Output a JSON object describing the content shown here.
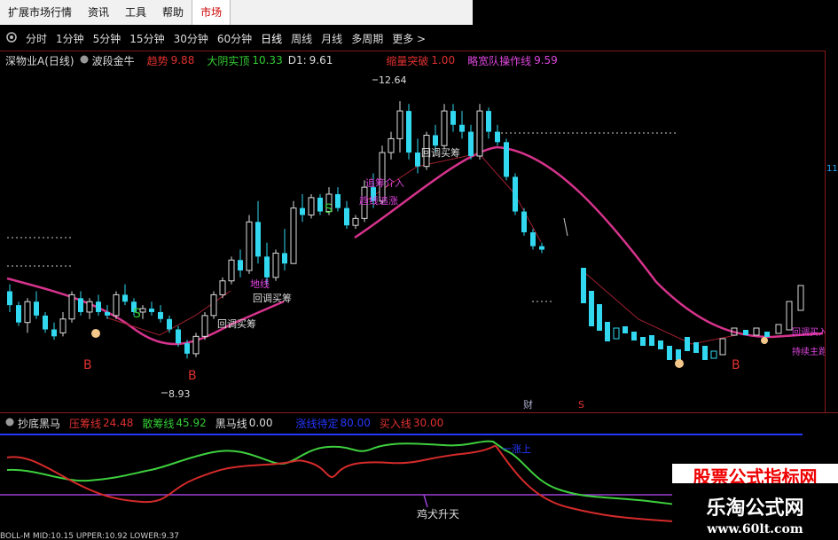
{
  "menu": {
    "items": [
      "扩展市场行情",
      "资讯",
      "工具",
      "帮助"
    ],
    "active": "市场"
  },
  "periods": {
    "items": [
      "分时",
      "1分钟",
      "5分钟",
      "15分钟",
      "30分钟",
      "60分钟",
      "日线",
      "周线",
      "月线",
      "多周期",
      "更多 >"
    ]
  },
  "main_indicators": {
    "stock": "深物业A(日线)",
    "formula": "波段金牛",
    "trend_label": "趋势",
    "trend_value": "9.88",
    "yang_label": "大阴实顶",
    "yang_value": "10.33",
    "d1_label": "D1:",
    "d1_value": "9.61",
    "shrink_label": "缩量突破",
    "shrink_value": "1.00",
    "operate_label": "略宽队操作线",
    "operate_value": "9.59"
  },
  "annotations": {
    "high": "12.64",
    "low": "8.93",
    "callback": "回调买筹",
    "callback2": "回调买筹",
    "callback3": "回调买筹",
    "buy_big": "地线",
    "trend_buy": "趋线追涨",
    "buy_left": "追筹介入",
    "buy_right": "回调买入",
    "right_label": "持续主跑",
    "b": "B",
    "s": "S",
    "cai": "财",
    "s2": "S",
    "axis_marker": "11"
  },
  "sub_indicators": {
    "name": "抄底黑马",
    "pressure_label": "压筹线",
    "pressure_value": "24.48",
    "retail_label": "散筹线",
    "retail_value": "45.92",
    "horse_label": "黑马线",
    "horse_value": "0.00",
    "neutral_label": "涨线待定",
    "neutral_value": "80.00",
    "buy_label": "买入线",
    "buy_value": "30.00",
    "signal": "鸡犬升天",
    "signal2": "一涨上"
  },
  "watermark": {
    "top": "股票公式指标网",
    "title": "乐淘公式网",
    "url": "www.60lt.com"
  },
  "bottom": {
    "text": "BOLL-M  MID:10.15  UPPER:10.92  LOWER:9.37"
  },
  "chart_data": {
    "type": "candlestick",
    "price_range": [
      8.5,
      13.0
    ],
    "sub_range": [
      0,
      100
    ],
    "candles": [
      [
        9.9,
        10.0,
        9.6,
        9.7
      ],
      [
        9.7,
        9.75,
        9.4,
        9.45
      ],
      [
        9.45,
        9.8,
        9.3,
        9.75
      ],
      [
        9.75,
        9.9,
        9.5,
        9.55
      ],
      [
        9.55,
        9.6,
        9.3,
        9.35
      ],
      [
        9.35,
        9.45,
        9.2,
        9.25
      ],
      [
        9.3,
        9.6,
        9.25,
        9.5
      ],
      [
        9.5,
        9.9,
        9.45,
        9.85
      ],
      [
        9.8,
        9.9,
        9.55,
        9.6
      ],
      [
        9.6,
        9.8,
        9.5,
        9.75
      ],
      [
        9.75,
        9.85,
        9.55,
        9.6
      ],
      [
        9.6,
        9.7,
        9.5,
        9.55
      ],
      [
        9.55,
        9.9,
        9.5,
        9.85
      ],
      [
        9.85,
        10.0,
        9.7,
        9.75
      ],
      [
        9.75,
        9.8,
        9.55,
        9.6
      ],
      [
        9.6,
        9.7,
        9.5,
        9.65
      ],
      [
        9.65,
        9.75,
        9.55,
        9.6
      ],
      [
        9.6,
        9.7,
        9.45,
        9.5
      ],
      [
        9.5,
        9.55,
        9.3,
        9.35
      ],
      [
        9.35,
        9.4,
        9.1,
        9.15
      ],
      [
        9.15,
        9.2,
        8.93,
        9.0
      ],
      [
        9.0,
        9.3,
        8.95,
        9.25
      ],
      [
        9.25,
        9.6,
        9.2,
        9.55
      ],
      [
        9.55,
        9.9,
        9.5,
        9.85
      ],
      [
        9.85,
        10.1,
        9.8,
        10.05
      ],
      [
        10.05,
        10.4,
        10.0,
        10.35
      ],
      [
        10.35,
        10.5,
        10.1,
        10.2
      ],
      [
        10.2,
        11.0,
        10.15,
        10.9
      ],
      [
        10.9,
        11.2,
        10.3,
        10.4
      ],
      [
        10.4,
        10.6,
        10.0,
        10.1
      ],
      [
        10.1,
        10.5,
        10.05,
        10.45
      ],
      [
        10.45,
        10.8,
        10.2,
        10.3
      ],
      [
        10.3,
        11.2,
        10.3,
        11.1
      ],
      [
        11.1,
        11.3,
        10.9,
        11.0
      ],
      [
        11.0,
        11.3,
        10.95,
        11.25
      ],
      [
        11.25,
        11.3,
        11.0,
        11.05
      ],
      [
        11.05,
        11.4,
        11.0,
        11.3
      ],
      [
        11.3,
        11.4,
        11.05,
        11.1
      ],
      [
        11.1,
        11.2,
        10.8,
        10.85
      ],
      [
        10.85,
        11.0,
        10.8,
        10.95
      ],
      [
        10.95,
        11.5,
        10.9,
        11.4
      ],
      [
        11.4,
        11.6,
        11.1,
        11.2
      ],
      [
        11.2,
        12.0,
        11.15,
        11.9
      ],
      [
        11.9,
        12.2,
        11.8,
        12.1
      ],
      [
        12.1,
        12.64,
        11.9,
        12.5
      ],
      [
        12.5,
        12.6,
        11.8,
        11.9
      ],
      [
        11.9,
        12.1,
        11.6,
        11.7
      ],
      [
        11.7,
        12.2,
        11.65,
        12.15
      ],
      [
        12.15,
        12.3,
        11.9,
        12.0
      ],
      [
        12.0,
        12.6,
        11.95,
        12.5
      ],
      [
        12.5,
        12.6,
        12.2,
        12.3
      ],
      [
        12.3,
        12.5,
        12.1,
        12.2
      ],
      [
        12.2,
        12.3,
        11.8,
        11.85
      ],
      [
        11.85,
        12.6,
        11.8,
        12.5
      ],
      [
        12.5,
        12.55,
        12.1,
        12.2
      ],
      [
        12.2,
        12.3,
        12.0,
        12.05
      ],
      [
        12.05,
        12.1,
        11.5,
        11.55
      ],
      [
        11.55,
        11.6,
        11.0,
        11.05
      ],
      [
        11.05,
        11.1,
        10.7,
        10.75
      ],
      [
        10.75,
        10.8,
        10.5,
        10.55
      ],
      [
        10.55,
        10.6,
        10.45,
        10.5
      ]
    ]
  }
}
